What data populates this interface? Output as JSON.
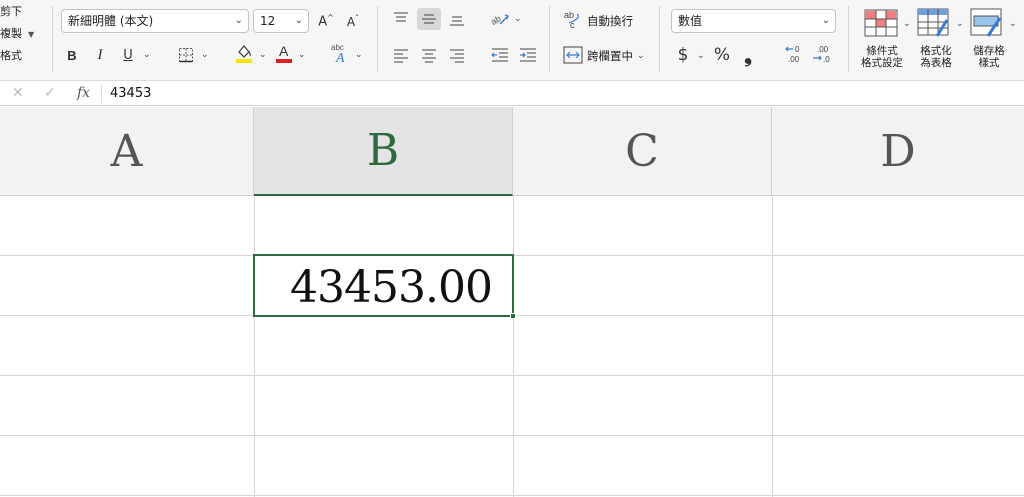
{
  "clipboard": {
    "cut": "剪下",
    "copy": "複製",
    "format": "格式"
  },
  "font": {
    "name": "新細明體 (本文)",
    "size": "12"
  },
  "format_buttons": {
    "bold": "B",
    "italic": "I",
    "underline": "U"
  },
  "alignment": {
    "wrap_text": "自動換行",
    "merge_center": "跨欄置中"
  },
  "number": {
    "format": "數值",
    "currency": "$",
    "percent": "%",
    "comma": "❟"
  },
  "styles": {
    "conditional": [
      "條件式",
      "格式設定"
    ],
    "as_table": [
      "格式化",
      "為表格"
    ],
    "cell_styles": [
      "儲存格",
      "樣式"
    ]
  },
  "formula_bar": {
    "fx": "fx",
    "value": "43453"
  },
  "columns": [
    "A",
    "B",
    "C",
    "D"
  ],
  "selected_column": "B",
  "active_cell": {
    "ref": "B2",
    "display": "43453.00"
  },
  "colors": {
    "accent": "#2d6a3f",
    "fill_color": "#f2e600",
    "font_color": "#e02020"
  }
}
